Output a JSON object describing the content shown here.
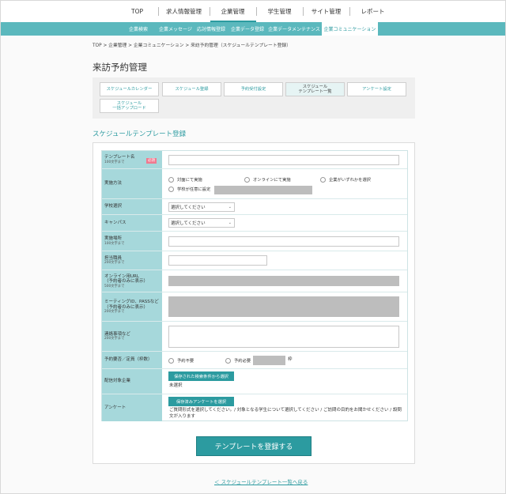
{
  "top_nav": {
    "items": [
      {
        "label": "TOP"
      },
      {
        "label": "求人情報管理"
      },
      {
        "label": "企業管理"
      },
      {
        "label": "学生管理"
      },
      {
        "label": "サイト管理"
      },
      {
        "label": "レポート"
      }
    ],
    "active_index": 2
  },
  "sub_nav": {
    "items": [
      {
        "label": "企業検索"
      },
      {
        "label": "企業メッセージ"
      },
      {
        "label": "応対情報登録"
      },
      {
        "label": "企業データ登録"
      },
      {
        "label": "企業データメンテナンス"
      },
      {
        "label": "企業コミュニケーション"
      }
    ],
    "active_index": 5
  },
  "breadcrumb": "TOP > 企業管理 > 企業コミュニケーション > 来訪予約管理（スケジュールテンプレート登録）",
  "page_title": "来訪予約管理",
  "tabs": [
    {
      "label": "スケジュールカレンダー"
    },
    {
      "label": "スケジュール登録"
    },
    {
      "label": "予約受付設定"
    },
    {
      "label_line1": "スケジュール",
      "label_line2": "テンプレート一覧"
    },
    {
      "label": "アンケート設定"
    },
    {
      "label_line1": "スケジュール",
      "label_line2": "一括アップロード"
    }
  ],
  "section_title": "スケジュールテンプレート登録",
  "form": {
    "template_name": {
      "label": "テンプレート名",
      "sub": "100文字まで",
      "required": "必須"
    },
    "method": {
      "label": "実施方法",
      "options": [
        "対面にて実施",
        "オンラインにて実施",
        "企業がいずれかを選択",
        "学校が任意に設定"
      ]
    },
    "school": {
      "label": "学校選択",
      "placeholder": "選択してください"
    },
    "campus": {
      "label": "キャンパス",
      "placeholder": "選択してください"
    },
    "place": {
      "label": "実施場所",
      "sub": "100文字まで"
    },
    "staff": {
      "label": "担当職員",
      "sub": "200文字まで"
    },
    "online_url": {
      "label_line1": "オンライン用URL",
      "label_line2": "（予約者のみに表示）",
      "sub": "500文字まで"
    },
    "meeting": {
      "label_line1": "ミーティングID、PASSなど",
      "label_line2": "（予約者のみに表示）",
      "sub": "200文字まで"
    },
    "notes": {
      "label": "連絡事項など",
      "sub": "200文字まで"
    },
    "reservation": {
      "label": "予約要否／定員（枠数）",
      "options": [
        "予約不要",
        "予約必要"
      ],
      "unit": "枠"
    },
    "target": {
      "label": "配信対象企業",
      "button": "保存された検索条件から選択",
      "status": "未選択"
    },
    "survey": {
      "label": "アンケート",
      "button": "保存済みアンケートを選択",
      "desc_line1": "ご質問形式を選択してください。/ 対象となる学生について選択してください / ご訪問の目的をお聞かせください / 設問",
      "desc_line2": "文が入ります"
    }
  },
  "submit_label": "テンプレートを登録する",
  "back_link": "＜ スケジュールテンプレート一覧へ戻る",
  "colors": {
    "accent": "#2c9ba0",
    "subnav": "#5bb8bd",
    "label_bg": "#a6d8db",
    "required": "#f07a90"
  }
}
